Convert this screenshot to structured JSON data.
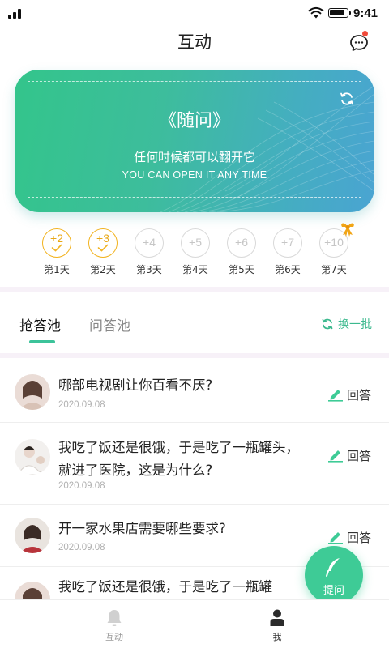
{
  "status_bar": {
    "time": "9:41"
  },
  "nav": {
    "title": "互动"
  },
  "banner": {
    "title": "《随问》",
    "subtitle": "任何时候都可以翻开它",
    "subtitle_en": "YOU CAN OPEN IT ANY TIME"
  },
  "checkin": {
    "days": [
      {
        "points": "+2",
        "label": "第1天",
        "done": true
      },
      {
        "points": "+3",
        "label": "第2天",
        "done": true
      },
      {
        "points": "+4",
        "label": "第3天",
        "done": false
      },
      {
        "points": "+5",
        "label": "第4天",
        "done": false
      },
      {
        "points": "+6",
        "label": "第5天",
        "done": false
      },
      {
        "points": "+7",
        "label": "第6天",
        "done": false
      },
      {
        "points": "+10",
        "label": "第7天",
        "done": false
      }
    ]
  },
  "tabs": {
    "items": [
      {
        "label": "抢答池"
      },
      {
        "label": "问答池"
      }
    ],
    "batch_label": "换一批"
  },
  "questions": [
    {
      "text": "哪部电视剧让你百看不厌?",
      "date": "2020.09.08",
      "action": "回答"
    },
    {
      "text": "我吃了饭还是很饿，于是吃了一瓶罐头，就进了医院，这是为什么?",
      "date": "2020.09.08",
      "action": "回答"
    },
    {
      "text": "开一家水果店需要哪些要求?",
      "date": "2020.09.08",
      "action": "回答"
    },
    {
      "text": "我吃了饭还是很饿，于是吃了一瓶罐",
      "date": "",
      "action": ""
    }
  ],
  "fab": {
    "label": "提问"
  },
  "tabbar": {
    "items": [
      {
        "label": "互动",
        "icon": "bell-icon"
      },
      {
        "label": "我",
        "icon": "user-icon"
      }
    ]
  },
  "colors": {
    "accent": "#3ecb96",
    "checkin_done": "#f2b320",
    "badge": "#f04a3a"
  }
}
